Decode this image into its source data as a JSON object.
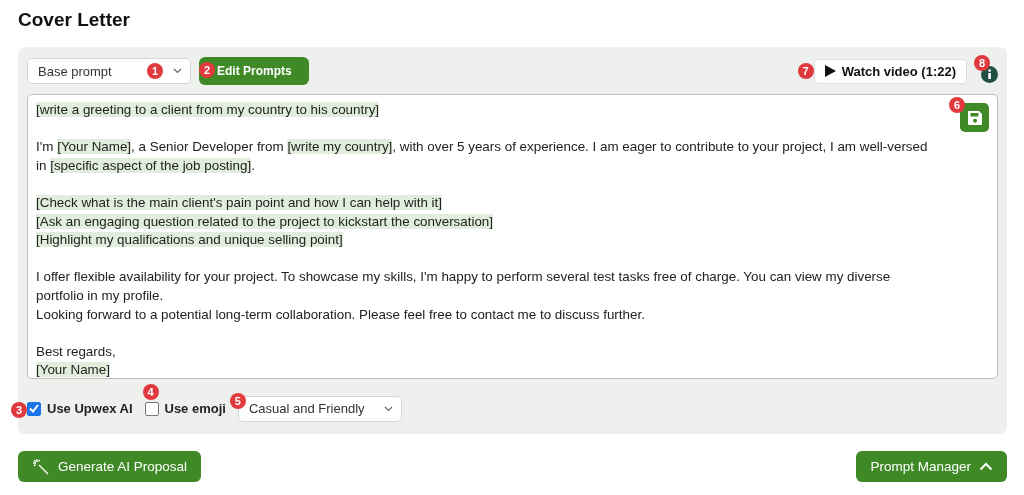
{
  "title": "Cover Letter",
  "toolbar": {
    "prompt_select": {
      "value": "Base prompt",
      "badge": "1"
    },
    "edit_button": {
      "label": "Edit Prompts",
      "badge": "2"
    },
    "watch_button": {
      "label": "Watch video (1:22)",
      "badge": "7"
    },
    "info_badge": "8"
  },
  "editor": {
    "save_badge": "6",
    "paragraphs": [
      [
        [
          {
            "text": "[write a greeting to a client from my country to his country]",
            "highlighted": true
          }
        ]
      ],
      [
        [
          {
            "text": "I'm ",
            "highlighted": false
          },
          {
            "text": "[Your Name]",
            "highlighted": true
          },
          {
            "text": ", a Senior Developer from ",
            "highlighted": false
          },
          {
            "text": "[write my country]",
            "highlighted": true
          },
          {
            "text": ", with over 5 years of experience. I am eager to contribute to your project, I am well-versed",
            "highlighted": false
          }
        ],
        [
          {
            "text": "in ",
            "highlighted": false
          },
          {
            "text": "[specific aspect of the job posting]",
            "highlighted": true
          },
          {
            "text": ".",
            "highlighted": false
          }
        ]
      ],
      [
        [
          {
            "text": "[Check what is the main client's pain point and how I can help with it]",
            "highlighted": true
          }
        ],
        [
          {
            "text": "[Ask an engaging question related to the project to kickstart the conversation]",
            "highlighted": true
          }
        ],
        [
          {
            "text": "[Highlight my qualifications and unique selling point]",
            "highlighted": true
          }
        ]
      ],
      [
        [
          {
            "text": "I offer flexible availability for your project. To showcase my skills, I'm happy to perform several test tasks free of charge. You can view my diverse",
            "highlighted": false
          }
        ],
        [
          {
            "text": "portfolio in my profile.",
            "highlighted": false
          }
        ],
        [
          {
            "text": "Looking forward to a potential long-term collaboration. Please feel free to contact me to discuss further.",
            "highlighted": false
          }
        ]
      ],
      [
        [
          {
            "text": "Best regards,",
            "highlighted": false
          }
        ],
        [
          {
            "text": "[Your Name]",
            "highlighted": true
          }
        ]
      ]
    ]
  },
  "options": {
    "checkboxes": [
      {
        "label": "Use Upwex AI",
        "checked": true,
        "badge": "3"
      },
      {
        "label": "Use emoji",
        "checked": false,
        "badge": "4"
      }
    ],
    "tone_select": {
      "value": "Casual and Friendly",
      "badge": "5"
    }
  },
  "footer": {
    "generate_button": "Generate AI Proposal",
    "manager_button": {
      "label": "Prompt Manager",
      "expanded": true
    }
  }
}
